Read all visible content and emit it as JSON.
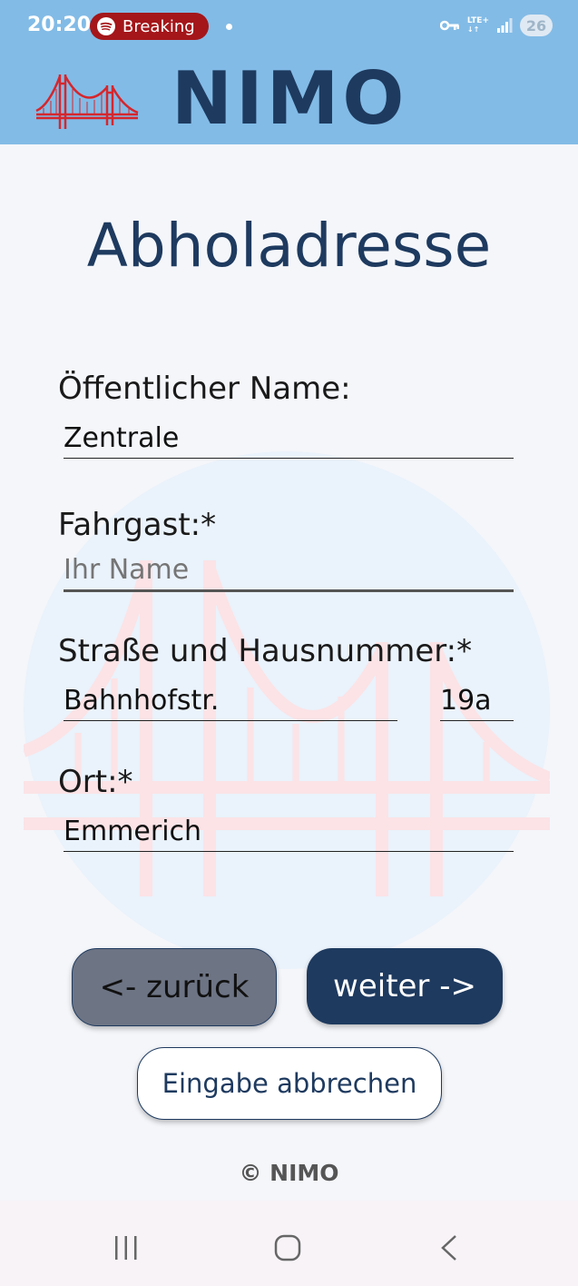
{
  "status_bar": {
    "time": "20:20",
    "media_label": "Breaking",
    "network": "LTE+",
    "battery": "26"
  },
  "app": {
    "brand": "NIMO"
  },
  "page": {
    "title": "Abholadresse"
  },
  "form": {
    "public_name": {
      "label": "Öffentlicher Name:",
      "value": "Zentrale"
    },
    "passenger": {
      "label": "Fahrgast:*",
      "placeholder": "Ihr Name",
      "value": ""
    },
    "street": {
      "label": "Straße und Hausnummer:*",
      "street_value": "Bahnhofstr.",
      "number_value": "19a"
    },
    "city": {
      "label": "Ort:*",
      "value": "Emmerich"
    }
  },
  "buttons": {
    "back": "<- zurück",
    "next": "weiter ->",
    "cancel": "Eingabe abbrechen"
  },
  "footer": {
    "copyright": "© NIMO"
  },
  "colors": {
    "header_bg": "#82bbe6",
    "brand": "#1e3a5f",
    "back_button": "#6d7484",
    "bridge_red": "#d6262c"
  },
  "icons": {
    "media": "spotify-icon",
    "logo": "bridge-logo-icon",
    "nav_recent": "recent-apps-icon",
    "nav_home": "home-icon",
    "nav_back": "back-icon"
  }
}
